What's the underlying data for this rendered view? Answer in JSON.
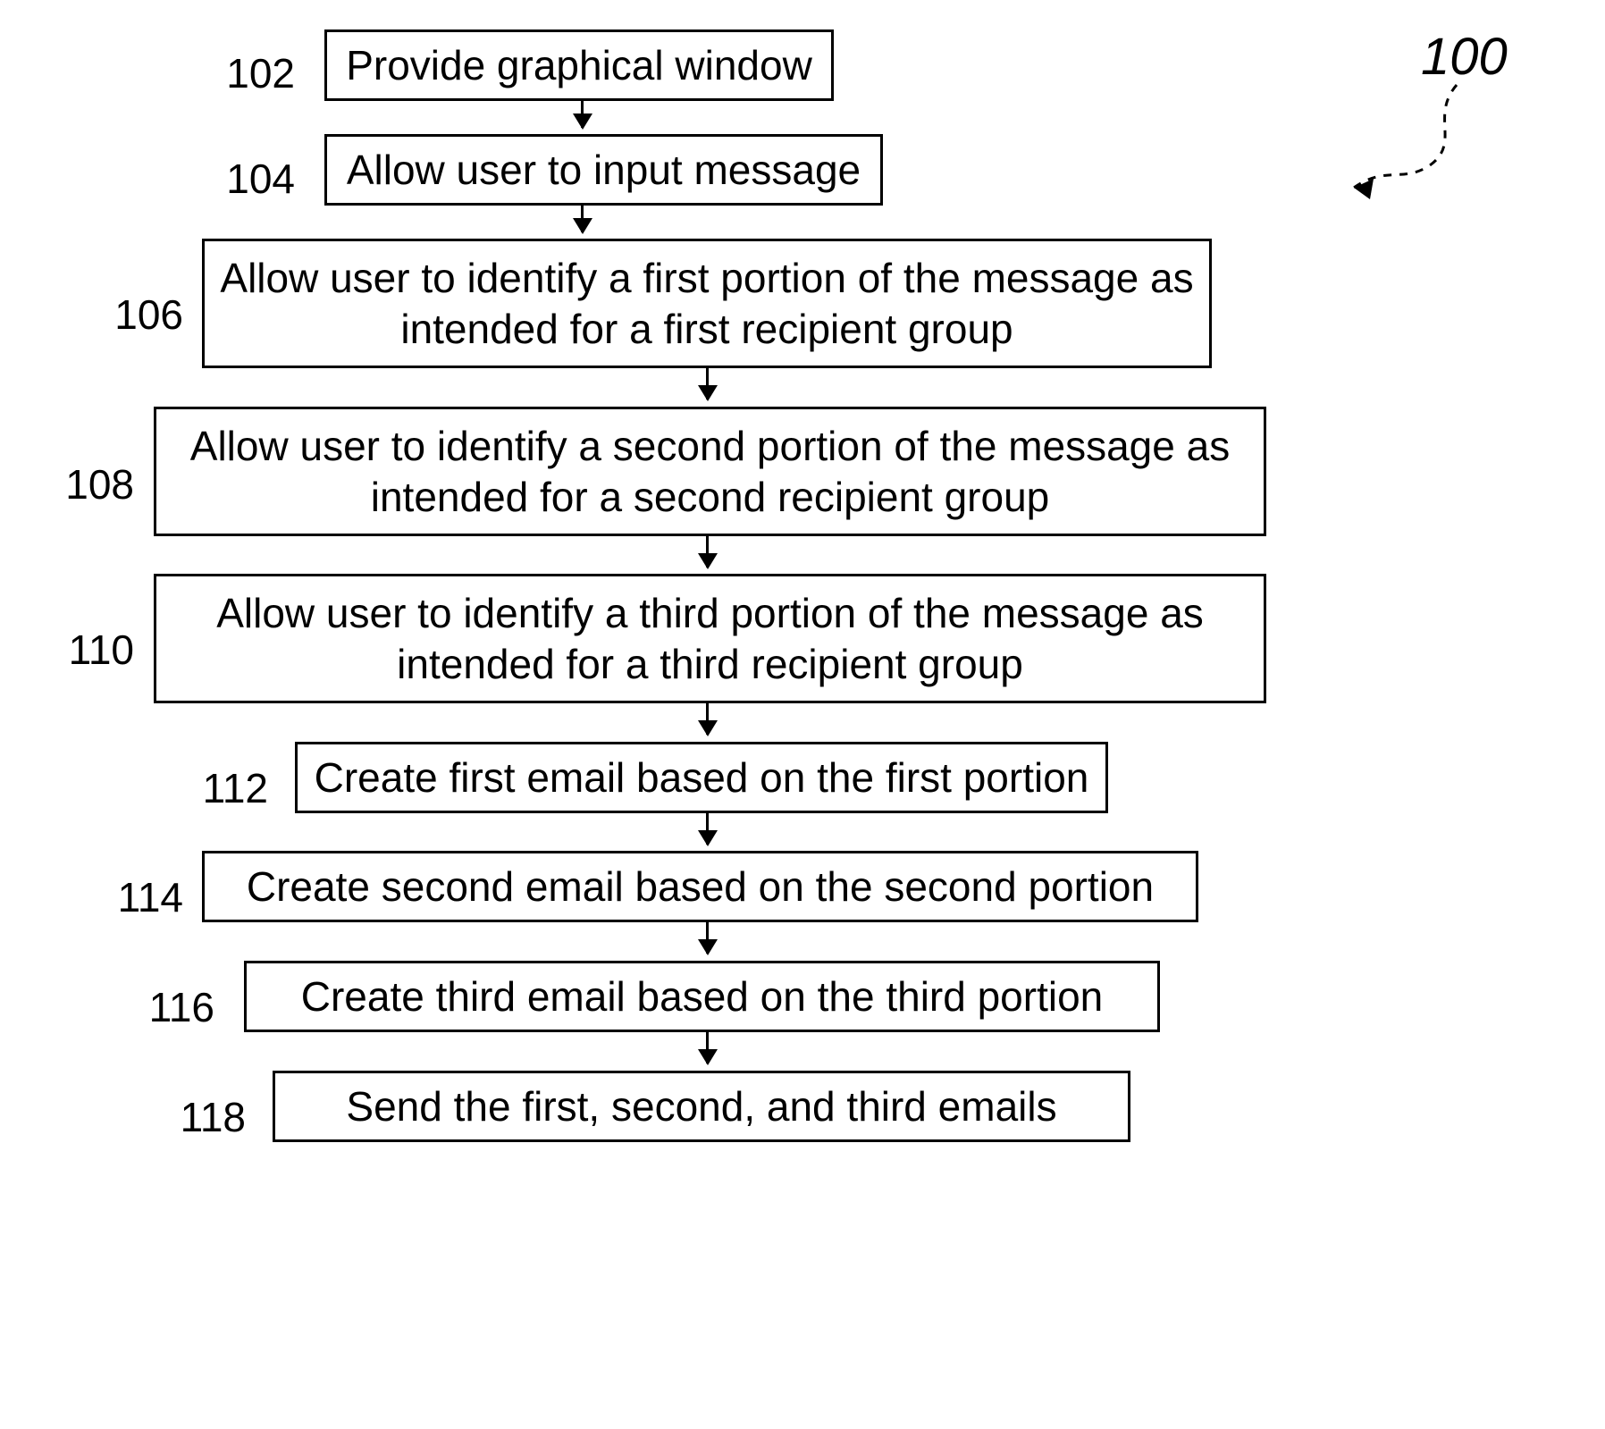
{
  "diagram_ref": "100",
  "steps": [
    {
      "num": "102",
      "text": "Provide graphical window"
    },
    {
      "num": "104",
      "text": "Allow user to input message"
    },
    {
      "num": "106",
      "text": "Allow user to identify a first portion of the message as intended for a first recipient group"
    },
    {
      "num": "108",
      "text": "Allow user to identify a second portion of the message as intended for a second recipient group"
    },
    {
      "num": "110",
      "text": "Allow user to identify a third portion of the message as intended for a third recipient group"
    },
    {
      "num": "112",
      "text": "Create first email based on the first portion"
    },
    {
      "num": "114",
      "text": "Create second email based on the second portion"
    },
    {
      "num": "116",
      "text": "Create third email based on the third portion"
    },
    {
      "num": "118",
      "text": "Send the first, second, and third emails"
    }
  ]
}
